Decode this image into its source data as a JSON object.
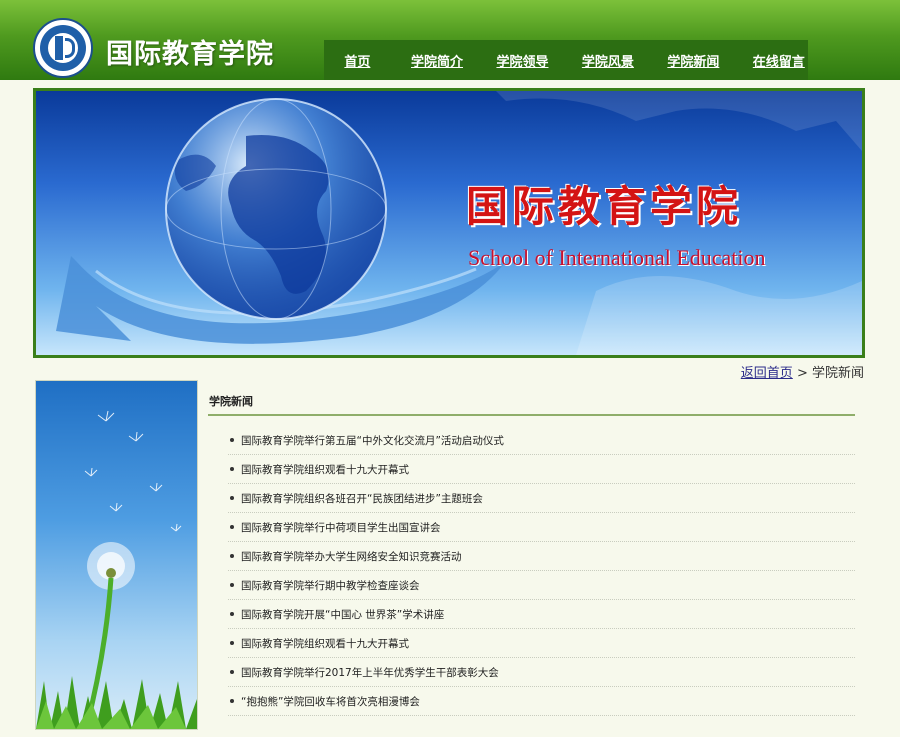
{
  "header": {
    "site_title": "国际教育学院",
    "nav": [
      "首页",
      "学院简介",
      "学院领导",
      "学院风景",
      "学院新闻",
      "在线留言"
    ]
  },
  "banner": {
    "title_cn": "国际教育学院",
    "title_en": "School of International Education"
  },
  "breadcrumb": {
    "home": "返回首页",
    "separator": ">",
    "current": "学院新闻"
  },
  "section": {
    "title": "学院新闻",
    "items": [
      "国际教育学院举行第五届“中外文化交流月”活动启动仪式",
      "国际教育学院组织观看十九大开幕式",
      "国际教育学院组织各班召开“民族团结进步”主题班会",
      "国际教育学院举行中荷项目学生出国宣讲会",
      "国际教育学院举办大学生网络安全知识竞赛活动",
      "国际教育学院举行期中教学检查座谈会",
      "国际教育学院开展“中国心 世界茶”学术讲座",
      "国际教育学院组织观看十九大开幕式",
      "国际教育学院举行2017年上半年优秀学生干部表彰大会",
      "“抱抱熊”学院回收车将首次亮相漫博会"
    ]
  },
  "colors": {
    "header_green": "#4f9a1f",
    "nav_green": "#2c6e12",
    "page_bg": "#f7f9ec",
    "banner_title_red": "#d41414"
  }
}
